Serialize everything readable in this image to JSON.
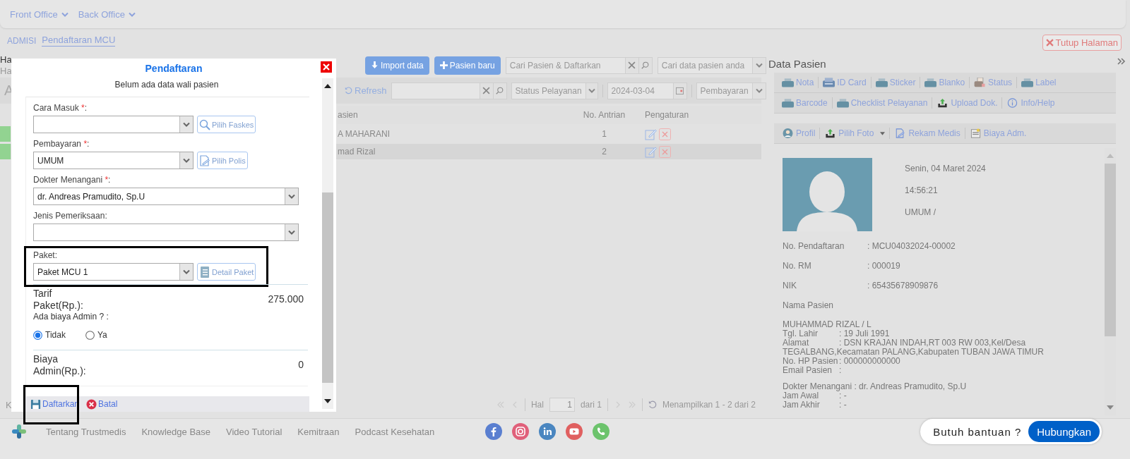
{
  "nav": {
    "menus": [
      "Front Office",
      "Back Office"
    ]
  },
  "breadcrumb": [
    {
      "label": "ADMISI",
      "selected": false
    },
    {
      "label": "Pendaftaran MCU",
      "selected": true
    }
  ],
  "close_page": "Tutup Halaman",
  "fragments": {
    "greeting": "Ha",
    "subtitle": "Ha",
    "tab": "A",
    "footer": "K"
  },
  "toolbar": {
    "buttons": [
      {
        "label": "Import data",
        "kind": "import"
      },
      {
        "label": "Pasien baru",
        "kind": "add"
      }
    ],
    "search": {
      "placeholder": "Cari Pasien & Daftarkan"
    },
    "filter": {
      "placeholder": "Cari data pasien anda"
    }
  },
  "filters": {
    "refresh": "Refresh",
    "status": {
      "placeholder": "Status Pelayanan"
    },
    "date": "2024-03-04",
    "payment": {
      "placeholder": "Pembayaran"
    }
  },
  "table": {
    "columns": [
      "asien",
      "No. Antrian",
      "Pengaturan"
    ],
    "rows": [
      {
        "name": "A MAHARANI",
        "queue": "1",
        "selected": false
      },
      {
        "name": "mad Rizal",
        "queue": "2",
        "selected": true
      }
    ]
  },
  "pagination": {
    "page_label": "Hal",
    "page": "1",
    "of": "dari 1",
    "summary": "Menampilkan 1 - 2 dari 2"
  },
  "modal": {
    "title": "Pendaftaran",
    "subtitle": "Belum ada data wali pasien",
    "fields": [
      {
        "label": "Cara Masuk",
        "required_mark": "*",
        "tail": ":",
        "button": {
          "label": "Pilih Faskes",
          "kind": "search"
        },
        "highlighted": false
      },
      {
        "label": "Pembayaran",
        "required_mark": "*",
        "tail": ":",
        "value": "UMUM",
        "button": {
          "label": "Pilih Polis",
          "kind": "policy"
        },
        "highlighted": false
      },
      {
        "label": "Dokter Menangani",
        "required_mark": "*",
        "tail": ":",
        "value": "dr. Andreas Pramudito, Sp.U",
        "highlighted": false
      },
      {
        "label": "Jenis Pemeriksaan:",
        "highlighted": false
      },
      {
        "label": "Paket:",
        "value": "Paket MCU 1",
        "button": {
          "label": "Detail Paket",
          "kind": "list"
        },
        "highlighted": true
      }
    ],
    "tariff": {
      "label": "Tarif Paket(Rp.):",
      "value": "275.000"
    },
    "admin": {
      "question": "Ada biaya Admin ? :",
      "options": [
        {
          "label": "Tidak",
          "selected": true
        },
        {
          "label": "Ya",
          "selected": false
        }
      ]
    },
    "admin_fee": {
      "label": "Biaya Admin(Rp.):",
      "value": "0"
    },
    "actions": [
      {
        "label": "Daftarkan",
        "kind": "save",
        "highlighted": true
      },
      {
        "label": "Batal",
        "kind": "cancel",
        "highlighted": false
      }
    ]
  },
  "patient_panel": {
    "title": "Data Pasien",
    "print_rows": [
      {
        "items": [
          {
            "label": "Nota",
            "kind": "printer"
          },
          {
            "label": "ID Card",
            "kind": "card"
          },
          {
            "label": "Sticker",
            "kind": "printer"
          },
          {
            "label": "Blanko",
            "kind": "printer"
          },
          {
            "label": "Status",
            "kind": "status"
          },
          {
            "label": "Label",
            "kind": "printer"
          }
        ]
      },
      {
        "items": [
          {
            "label": "Barcode",
            "kind": "printer"
          },
          {
            "label": "Checklist Pelayanan",
            "kind": "printer"
          },
          {
            "label": "Upload Dok.",
            "kind": "upload"
          },
          {
            "label": "Info/Help",
            "kind": "info"
          }
        ]
      }
    ],
    "actions": [
      {
        "label": "Profil",
        "kind": "profile",
        "dropdown": false
      },
      {
        "label": "Pilih Foto",
        "kind": "upload",
        "dropdown": true
      },
      {
        "label": "Rekam Medis",
        "kind": "document",
        "dropdown": false
      },
      {
        "label": "Biaya Adm.",
        "kind": "form",
        "dropdown": false
      }
    ],
    "visit": [
      "Senin, 04 Maret 2024",
      "14:56:21",
      "UMUM /"
    ],
    "details": [
      {
        "label": "No. Pendaftaran",
        "value": ": MCU04032024-00002"
      },
      {
        "label": "No. RM",
        "value": ": 000019"
      },
      {
        "label": "NIK",
        "value": ": 65435678909876"
      }
    ],
    "name_label": "Nama Pasien",
    "patient_name": "MUHAMMAD RIZAL / L",
    "info": [
      {
        "label": "Tgl. Lahir",
        "value": ": 19 Juli 1991"
      },
      {
        "label": "Alamat",
        "value": ": DSN KRAJAN INDAH,RT 003 RW 003,Kel/Desa TEGALBANG,Kecamatan PALANG,Kabupaten TUBAN JAWA TIMUR"
      },
      {
        "label": "No. HP Pasien",
        "value": ": 000000000000"
      },
      {
        "label": "Email Pasien",
        "value": ":"
      }
    ],
    "doctor": {
      "label": "Dokter Menangani",
      "value": ": dr. Andreas Pramudito, Sp.U"
    },
    "times": [
      {
        "label": "Jam Awal",
        "value": ": -"
      },
      {
        "label": "Jam Akhir",
        "value": ": -"
      }
    ]
  },
  "footer": {
    "links": [
      "Tentang Trustmedis",
      "Knowledge Base",
      "Video Tutorial",
      "Kemitraan",
      "Podcast Kesehatan"
    ],
    "socials": [
      {
        "kind": "facebook"
      },
      {
        "kind": "instagram"
      },
      {
        "kind": "linkedin"
      },
      {
        "kind": "youtube"
      },
      {
        "kind": "phone"
      }
    ],
    "help": {
      "text": "Butuh bantuan ?",
      "button": "Hubungkan"
    }
  }
}
